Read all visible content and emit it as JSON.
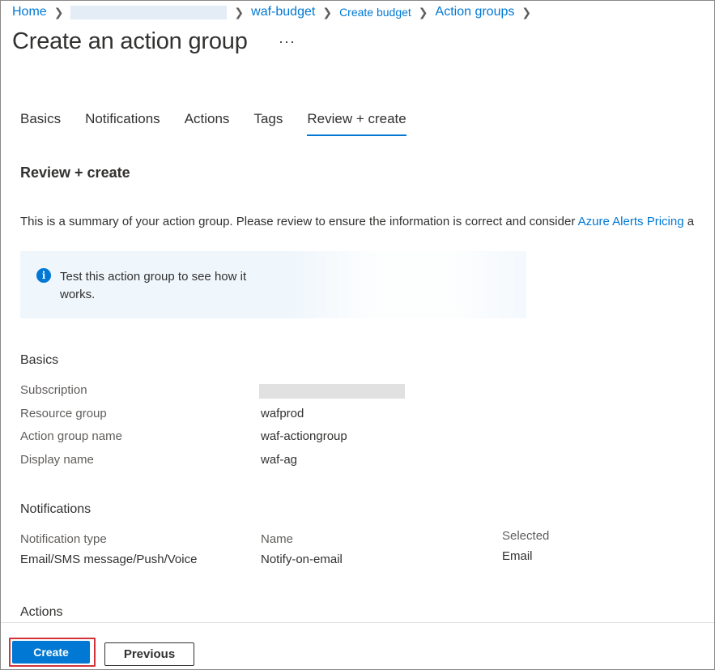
{
  "breadcrumb": {
    "home": "Home",
    "budget": "waf-budget",
    "create_budget": "Create budget",
    "action_groups": "Action groups"
  },
  "page": {
    "title": "Create an action group",
    "more": "···"
  },
  "tabs": [
    {
      "label": "Basics",
      "active": false
    },
    {
      "label": "Notifications",
      "active": false
    },
    {
      "label": "Actions",
      "active": false
    },
    {
      "label": "Tags",
      "active": false
    },
    {
      "label": "Review + create",
      "active": true
    }
  ],
  "review": {
    "heading": "Review + create",
    "summary": "This is a summary of your action group. Please review to ensure the information is correct and consider ",
    "pricing_link": "Azure Alerts Pricing",
    "summary_tail": " a",
    "info_text": "Test this action group to see how it works."
  },
  "basics": {
    "title": "Basics",
    "subscription_label": "Subscription",
    "resource_group_label": "Resource group",
    "resource_group_value": "wafprod",
    "action_group_name_label": "Action group name",
    "action_group_name_value": "waf-actiongroup",
    "display_name_label": "Display name",
    "display_name_value": "waf-ag"
  },
  "notifications": {
    "title": "Notifications",
    "type_header": "Notification type",
    "name_header": "Name",
    "selected_header": "Selected",
    "type_value": "Email/SMS message/Push/Voice",
    "name_value": "Notify-on-email",
    "selected_value": "Email"
  },
  "actions": {
    "title": "Actions"
  },
  "footer": {
    "create_label": "Create",
    "previous_label": "Previous"
  },
  "colors": {
    "accent": "#0078d4",
    "highlight": "#d13438"
  }
}
